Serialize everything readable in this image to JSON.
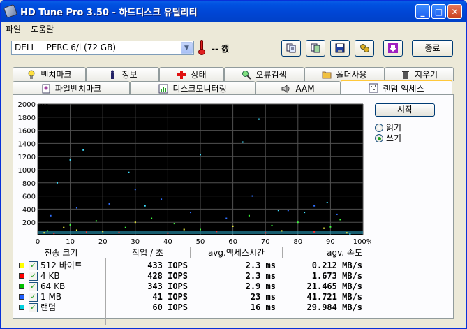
{
  "window": {
    "title": "HD Tune Pro 3.50 - 하드디스크 유틸리티"
  },
  "menu": {
    "items": [
      "파일",
      "도움말"
    ]
  },
  "toolbar": {
    "drive": "DELL    PERC 6/i (72 GB)",
    "temperature": "-- 캜",
    "exit_label": "종료",
    "icons": [
      "copy-text-icon",
      "copy-screen-icon",
      "save-icon",
      "options-icon",
      "download-icon"
    ]
  },
  "tabs": {
    "row1": [
      {
        "label": "벤치마크",
        "icon": "lightbulb-icon"
      },
      {
        "label": "정보",
        "icon": "info-icon"
      },
      {
        "label": "상태",
        "icon": "health-cross-icon"
      },
      {
        "label": "오류검색",
        "icon": "magnifier-icon"
      },
      {
        "label": "폴더사용",
        "icon": "folder-icon"
      },
      {
        "label": "지우기",
        "icon": "trash-icon"
      }
    ],
    "row2": [
      {
        "label": "파일벤치마크",
        "icon": "file-benchmark-icon"
      },
      {
        "label": "디스크모니터링",
        "icon": "monitor-chart-icon"
      },
      {
        "label": "AAM",
        "icon": "speaker-icon"
      },
      {
        "label": "랜덤 액세스",
        "icon": "random-access-icon"
      }
    ],
    "active": "랜덤 액세스"
  },
  "controls": {
    "start_label": "시작",
    "radio_read": "읽기",
    "radio_write": "쓰기",
    "selected": "쓰기"
  },
  "chart_data": {
    "type": "scatter",
    "y_unit": "ms",
    "ylim": [
      0,
      2000
    ],
    "y_ticks": [
      "2000",
      "1800",
      "1600",
      "1400",
      "1200",
      "1000",
      "800",
      "600",
      "400",
      "200"
    ],
    "x_ticks": [
      "0",
      "10",
      "20",
      "30",
      "40",
      "50",
      "60",
      "70",
      "80",
      "90",
      "100%"
    ],
    "xlim": [
      0,
      100
    ],
    "grid": true,
    "series": [
      {
        "color": "#ffff40",
        "points": [
          [
            2,
            40
          ],
          [
            8,
            120
          ],
          [
            12,
            80
          ],
          [
            20,
            60
          ],
          [
            30,
            200
          ],
          [
            45,
            90
          ],
          [
            60,
            140
          ],
          [
            75,
            70
          ],
          [
            88,
            110
          ],
          [
            95,
            40
          ]
        ]
      },
      {
        "color": "#ff3030",
        "points": [
          [
            5,
            30
          ],
          [
            15,
            50
          ],
          [
            25,
            45
          ],
          [
            40,
            35
          ],
          [
            55,
            60
          ],
          [
            70,
            40
          ],
          [
            85,
            55
          ]
        ]
      },
      {
        "color": "#40ff40",
        "points": [
          [
            3,
            70
          ],
          [
            10,
            160
          ],
          [
            18,
            220
          ],
          [
            27,
            120
          ],
          [
            35,
            260
          ],
          [
            42,
            180
          ],
          [
            50,
            90
          ],
          [
            65,
            300
          ],
          [
            72,
            150
          ],
          [
            80,
            200
          ],
          [
            90,
            130
          ],
          [
            93,
            240
          ]
        ]
      },
      {
        "color": "#3070ff",
        "points": [
          [
            4,
            300
          ],
          [
            12,
            420
          ],
          [
            22,
            480
          ],
          [
            30,
            700
          ],
          [
            38,
            550
          ],
          [
            47,
            350
          ],
          [
            58,
            260
          ],
          [
            66,
            600
          ],
          [
            77,
            380
          ],
          [
            85,
            450
          ],
          [
            92,
            320
          ]
        ]
      },
      {
        "color": "#40e0ff",
        "points": [
          [
            6,
            800
          ],
          [
            10,
            1150
          ],
          [
            14,
            1300
          ],
          [
            28,
            960
          ],
          [
            33,
            450
          ],
          [
            50,
            1230
          ],
          [
            63,
            1420
          ],
          [
            68,
            1770
          ],
          [
            74,
            380
          ],
          [
            82,
            350
          ],
          [
            89,
            500
          ],
          [
            96,
            20
          ]
        ]
      }
    ]
  },
  "results": {
    "headers": [
      "전송 크기",
      "작업 / 초",
      "avg.액세스시간",
      "agv. 속도"
    ],
    "rows": [
      {
        "color": "#ffff00",
        "size": "512 바이트",
        "iops": "433 IOPS",
        "time": "2.3 ms",
        "speed": "0.212 MB/s"
      },
      {
        "color": "#ff0000",
        "size": "4 KB",
        "iops": "428 IOPS",
        "time": "2.3 ms",
        "speed": "1.673 MB/s"
      },
      {
        "color": "#00c000",
        "size": "64 KB",
        "iops": "343 IOPS",
        "time": "2.9 ms",
        "speed": "21.465 MB/s"
      },
      {
        "color": "#2060ff",
        "size": "1 MB",
        "iops": "41 IOPS",
        "time": "23 ms",
        "speed": "41.721 MB/s"
      },
      {
        "color": "#00d0e0",
        "size": "랜덤",
        "iops": "60 IOPS",
        "time": "16 ms",
        "speed": "29.984 MB/s"
      }
    ]
  }
}
